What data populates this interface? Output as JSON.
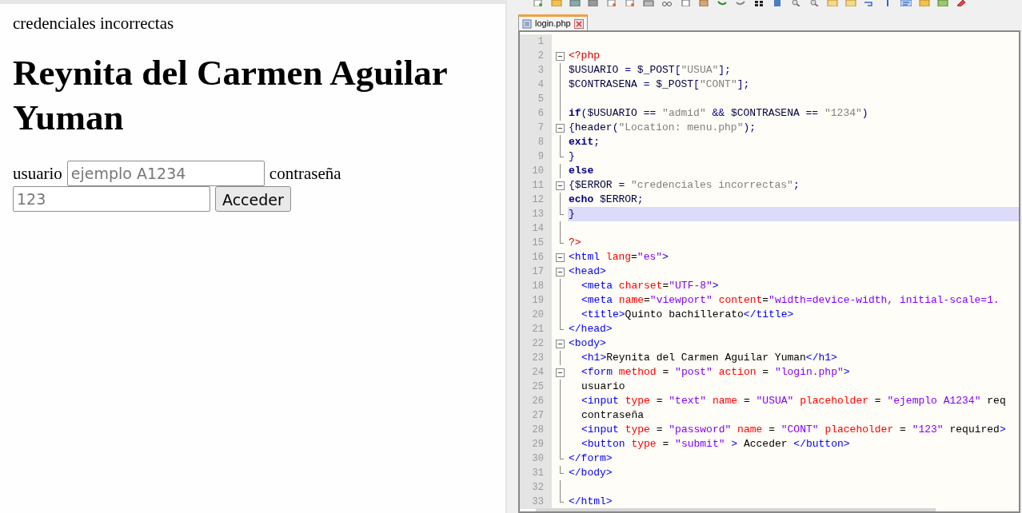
{
  "browser": {
    "message": "credenciales incorrectas",
    "heading": "Reynita del Carmen Aguilar Yuman",
    "form": {
      "user_label": "usuario",
      "user_field": {
        "placeholder": "ejemplo A1234"
      },
      "password_label": "contraseña",
      "password_field": {
        "placeholder": "123"
      },
      "submit": "Acceder"
    }
  },
  "editor": {
    "tabs": [
      {
        "label": "login.php",
        "selected": true
      }
    ],
    "lines": [
      {
        "number": "1",
        "kind": "plain",
        "selected": false
      },
      {
        "number": "2",
        "kind": "open",
        "selected": false,
        "indented": false,
        "tokens": [
          {
            "kind": "php",
            "text": "<?php"
          }
        ]
      },
      {
        "number": "3",
        "kind": "mid",
        "selected": false,
        "indented": false,
        "tokens": [
          {
            "kind": "var",
            "text": "$USUARIO"
          },
          {
            "kind": "op",
            "text": "="
          },
          {
            "kind": "var",
            "text": "$_POST"
          },
          {
            "kind": "op",
            "text": "["
          },
          {
            "kind": "str",
            "text": "\"USUA\""
          },
          {
            "kind": "op",
            "text": "];"
          }
        ]
      },
      {
        "number": "4",
        "kind": "mid",
        "selected": false,
        "indented": false,
        "tokens": [
          {
            "kind": "var",
            "text": "$CONTRASENA"
          },
          {
            "kind": "op",
            "text": "="
          },
          {
            "kind": "var",
            "text": "$_POST"
          },
          {
            "kind": "op",
            "text": "["
          },
          {
            "kind": "str",
            "text": "\"CONT\""
          },
          {
            "kind": "op",
            "text": "];"
          }
        ]
      },
      {
        "number": "5",
        "kind": "mid",
        "selected": false
      },
      {
        "number": "6",
        "kind": "mid",
        "selected": false,
        "indented": false,
        "tokens": [
          {
            "kind": "kw",
            "text": "if"
          },
          {
            "kind": "op",
            "text": "("
          },
          {
            "kind": "var",
            "text": "$USUARIO"
          },
          {
            "kind": "op",
            "text": "=="
          },
          {
            "kind": "str",
            "text": "\"admid\""
          },
          {
            "kind": "op",
            "text": "&&"
          },
          {
            "kind": "var",
            "text": "$CONTRASENA"
          },
          {
            "kind": "op",
            "text": "=="
          },
          {
            "kind": "str",
            "text": "\"1234\""
          },
          {
            "kind": "op",
            "text": ")"
          }
        ]
      },
      {
        "number": "7",
        "kind": "open",
        "selected": false,
        "indented": false,
        "tokens": [
          {
            "kind": "op",
            "text": "{"
          },
          {
            "kind": "var",
            "text": "header"
          },
          {
            "kind": "op",
            "text": "("
          },
          {
            "kind": "str",
            "text": "\"Location: menu.php\""
          },
          {
            "kind": "op",
            "text": ");"
          }
        ]
      },
      {
        "number": "8",
        "kind": "mid",
        "selected": false,
        "indented": false,
        "tokens": [
          {
            "kind": "kw",
            "text": "exit"
          },
          {
            "kind": "op",
            "text": ";"
          }
        ]
      },
      {
        "number": "9",
        "kind": "end",
        "selected": false,
        "indented": false,
        "tokens": [
          {
            "kind": "op",
            "text": "}"
          }
        ]
      },
      {
        "number": "10",
        "kind": "mid",
        "selected": false,
        "indented": false,
        "tokens": [
          {
            "kind": "kw",
            "text": "else"
          }
        ]
      },
      {
        "number": "11",
        "kind": "open",
        "selected": false,
        "indented": false,
        "tokens": [
          {
            "kind": "op",
            "text": "{"
          },
          {
            "kind": "var",
            "text": "$ERROR"
          },
          {
            "kind": "op",
            "text": "="
          },
          {
            "kind": "str",
            "text": "\"credenciales incorrectas\""
          },
          {
            "kind": "op",
            "text": ";"
          }
        ]
      },
      {
        "number": "12",
        "kind": "mid",
        "selected": false,
        "indented": false,
        "tokens": [
          {
            "kind": "kw",
            "text": "echo"
          },
          {
            "kind": "var",
            "text": "$ERROR"
          },
          {
            "kind": "op",
            "text": ";"
          }
        ]
      },
      {
        "number": "13",
        "kind": "end",
        "selected": true,
        "indented": false,
        "tokens": [
          {
            "kind": "op",
            "text": "}"
          }
        ]
      },
      {
        "number": "14",
        "kind": "mid",
        "selected": false
      },
      {
        "number": "15",
        "kind": "end",
        "selected": false,
        "indented": false,
        "tokens": [
          {
            "kind": "php",
            "text": "?>"
          }
        ]
      },
      {
        "number": "16",
        "kind": "open",
        "selected": false,
        "indented": false,
        "tokens": [
          {
            "kind": "tag",
            "text": "<html"
          },
          {
            "kind": "attr",
            "text": "lang"
          },
          {
            "kind": "eq",
            "text": "="
          },
          {
            "kind": "value",
            "text": "\"es\""
          },
          {
            "kind": "tag",
            "text": ">"
          }
        ]
      },
      {
        "number": "17",
        "kind": "open",
        "selected": false,
        "indented": false,
        "tokens": [
          {
            "kind": "tag",
            "text": "<head>"
          }
        ]
      },
      {
        "number": "18",
        "kind": "mid",
        "selected": false,
        "indented": true,
        "tokens": [
          {
            "kind": "tag",
            "text": "<meta"
          },
          {
            "kind": "attr",
            "text": "charset"
          },
          {
            "kind": "eq",
            "text": "="
          },
          {
            "kind": "value",
            "text": "\"UTF-8\""
          },
          {
            "kind": "tag",
            "text": ">"
          }
        ]
      },
      {
        "number": "19",
        "kind": "mid",
        "selected": false,
        "indented": true,
        "tokens": [
          {
            "kind": "tag",
            "text": "<meta"
          },
          {
            "kind": "attr",
            "text": "name"
          },
          {
            "kind": "eq",
            "text": "="
          },
          {
            "kind": "value",
            "text": "\"viewport\""
          },
          {
            "kind": "attr",
            "text": "content"
          },
          {
            "kind": "eq",
            "text": "="
          },
          {
            "kind": "value",
            "text": "\"width=device-width, initial-scale=1."
          }
        ]
      },
      {
        "number": "20",
        "kind": "mid",
        "selected": false,
        "indented": true,
        "tokens": [
          {
            "kind": "tag",
            "text": "<title>"
          },
          {
            "kind": "text",
            "text": "Quinto bachillerato"
          },
          {
            "kind": "tag",
            "text": "</title>"
          }
        ]
      },
      {
        "number": "21",
        "kind": "end",
        "selected": false,
        "indented": false,
        "tokens": [
          {
            "kind": "tag",
            "text": "</head>"
          }
        ]
      },
      {
        "number": "22",
        "kind": "open",
        "selected": false,
        "indented": false,
        "tokens": [
          {
            "kind": "tag",
            "text": "<body>"
          }
        ]
      },
      {
        "number": "23",
        "kind": "mid",
        "selected": false,
        "indented": true,
        "tokens": [
          {
            "kind": "tag",
            "text": "<h1>"
          },
          {
            "kind": "text",
            "text": "Reynita del Carmen Aguilar Yuman"
          },
          {
            "kind": "tag",
            "text": "</h1>"
          }
        ]
      },
      {
        "number": "24",
        "kind": "open",
        "selected": false,
        "indented": true,
        "tokens": [
          {
            "kind": "tag",
            "text": "<form"
          },
          {
            "kind": "attr",
            "text": "method"
          },
          {
            "kind": "op2",
            "text": "="
          },
          {
            "kind": "value",
            "text": "\"post\""
          },
          {
            "kind": "attr",
            "text": "action"
          },
          {
            "kind": "op2",
            "text": "="
          },
          {
            "kind": "value",
            "text": "\"login.php\""
          },
          {
            "kind": "tag",
            "text": ">"
          }
        ]
      },
      {
        "number": "25",
        "kind": "mid",
        "selected": false,
        "indented": true,
        "tokens": [
          {
            "kind": "text",
            "text": "usuario"
          }
        ]
      },
      {
        "number": "26",
        "kind": "mid",
        "selected": false,
        "indented": true,
        "tokens": [
          {
            "kind": "tag",
            "text": "<input"
          },
          {
            "kind": "attr",
            "text": "type"
          },
          {
            "kind": "op2",
            "text": "="
          },
          {
            "kind": "value",
            "text": "\"text\""
          },
          {
            "kind": "attr",
            "text": "name"
          },
          {
            "kind": "op2",
            "text": "="
          },
          {
            "kind": "value",
            "text": "\"USUA\""
          },
          {
            "kind": "attr",
            "text": "placeholder"
          },
          {
            "kind": "op2",
            "text": "="
          },
          {
            "kind": "value",
            "text": "\"ejemplo A1234\""
          },
          {
            "kind": "word",
            "text": "req"
          }
        ]
      },
      {
        "number": "27",
        "kind": "mid",
        "selected": false,
        "indented": true,
        "tokens": [
          {
            "kind": "text",
            "text": "contraseña"
          }
        ]
      },
      {
        "number": "28",
        "kind": "mid",
        "selected": false,
        "indented": true,
        "tokens": [
          {
            "kind": "tag",
            "text": "<input"
          },
          {
            "kind": "attr",
            "text": "type"
          },
          {
            "kind": "op2",
            "text": "="
          },
          {
            "kind": "value",
            "text": "\"password\""
          },
          {
            "kind": "attr",
            "text": "name"
          },
          {
            "kind": "op2",
            "text": "="
          },
          {
            "kind": "value",
            "text": "\"CONT\""
          },
          {
            "kind": "attr",
            "text": "placeholder"
          },
          {
            "kind": "op2",
            "text": "="
          },
          {
            "kind": "value",
            "text": "\"123\""
          },
          {
            "kind": "word",
            "text": "required"
          },
          {
            "kind": "tag",
            "text": ">"
          }
        ]
      },
      {
        "number": "29",
        "kind": "mid",
        "selected": false,
        "indented": true,
        "tokens": [
          {
            "kind": "tag",
            "text": "<button"
          },
          {
            "kind": "attr",
            "text": "type"
          },
          {
            "kind": "op2",
            "text": "="
          },
          {
            "kind": "value",
            "text": "\"submit\""
          },
          {
            "kind": "tagsp",
            "text": ">"
          },
          {
            "kind": "word",
            "text": "Acceder"
          },
          {
            "kind": "tagsp",
            "text": "</button>"
          }
        ]
      },
      {
        "number": "30",
        "kind": "end",
        "selected": false,
        "indented": false,
        "tokens": [
          {
            "kind": "tag",
            "text": "</form>"
          }
        ]
      },
      {
        "number": "31",
        "kind": "end",
        "selected": false,
        "indented": false,
        "tokens": [
          {
            "kind": "tag",
            "text": "</body>"
          }
        ]
      },
      {
        "number": "32",
        "kind": "mid",
        "selected": false
      },
      {
        "number": "33",
        "kind": "end",
        "selected": false,
        "indented": false,
        "tokens": [
          {
            "kind": "tag",
            "text": "</html>"
          }
        ]
      }
    ]
  }
}
